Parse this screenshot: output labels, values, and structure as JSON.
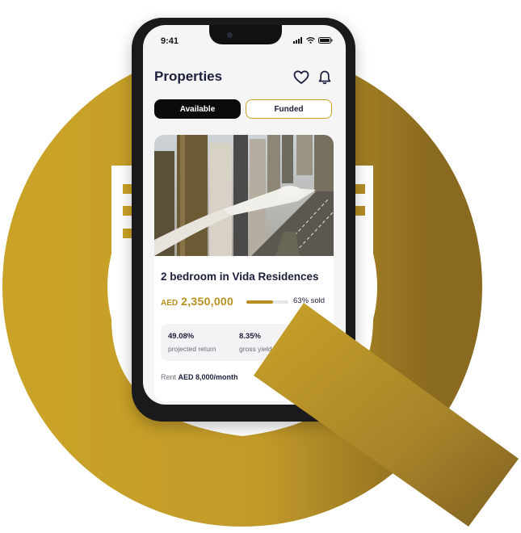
{
  "status_bar": {
    "time": "9:41"
  },
  "header": {
    "title": "Properties",
    "icons": [
      "heart-icon",
      "bell-icon"
    ]
  },
  "tabs": [
    {
      "label": "Available",
      "active": true
    },
    {
      "label": "Funded",
      "active": false
    }
  ],
  "property": {
    "title": "2 bedroom in Vida Residences",
    "currency": "AED",
    "price": "2,350,000",
    "sold_fraction": 0.63,
    "sold_text": "63% sold",
    "stats": [
      {
        "value": "49.08%",
        "label": "projected return"
      },
      {
        "value": "8.35%",
        "label": "gross yield"
      }
    ],
    "rent_label": "Rent",
    "rent_value": "AED 8,000/month"
  },
  "colors": {
    "gold": "#c9a227",
    "dark_gold": "#8a6a1f",
    "navy": "#1b1f3b"
  }
}
